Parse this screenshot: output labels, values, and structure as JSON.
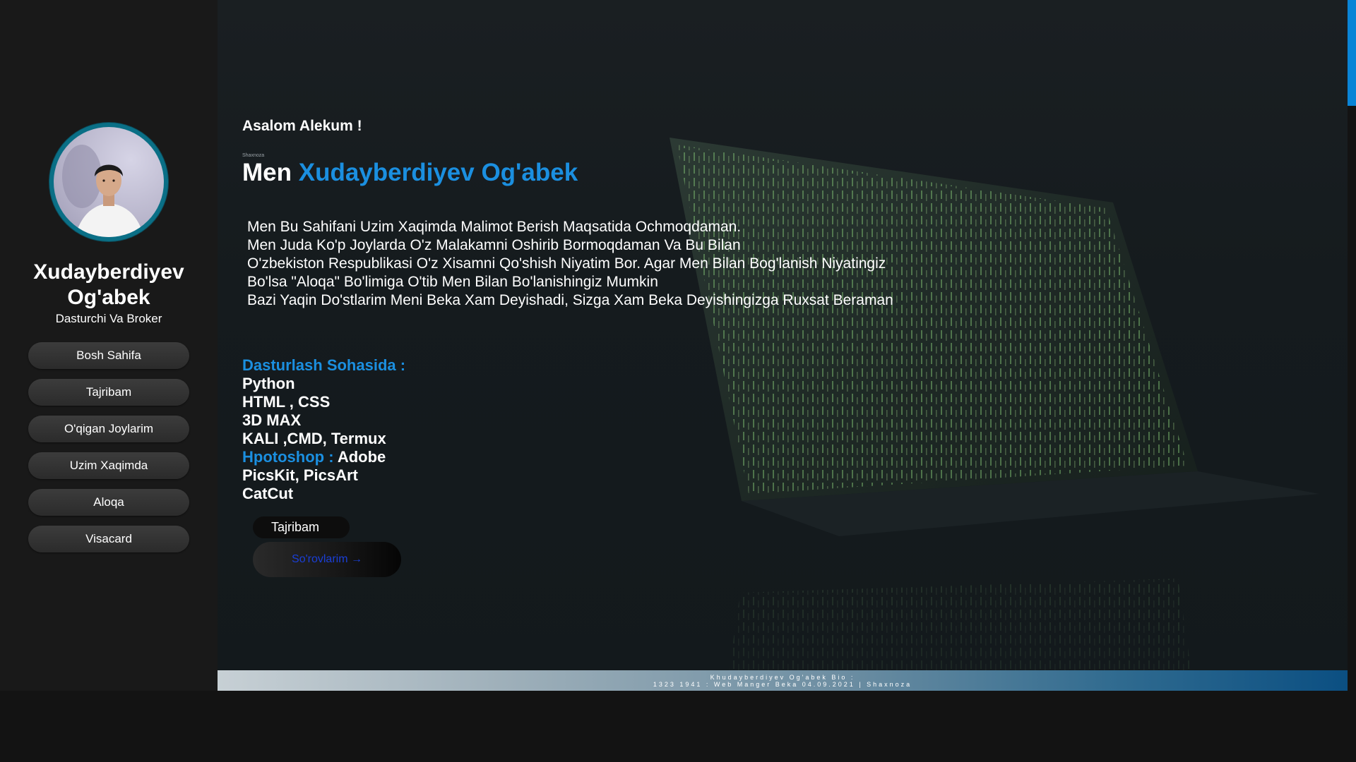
{
  "sidebar": {
    "name_line1": "Xudayberdiyev",
    "name_line2": "Og'abek",
    "role": "Dasturchi Va Broker",
    "nav": [
      {
        "label": "Bosh Sahifa"
      },
      {
        "label": "Tajribam"
      },
      {
        "label": "O'qigan Joylarim"
      },
      {
        "label": "Uzim Xaqimda"
      },
      {
        "label": "Aloqa"
      },
      {
        "label": "Visacard"
      }
    ]
  },
  "main": {
    "greeting": "Asalom Alekum !",
    "tiny_label": "Shaxnoza",
    "headline_prefix": "Men ",
    "headline_name": "Xudayberdiyev Og'abek",
    "bio": [
      "Men Bu Sahifani Uzim Xaqimda Malimot Berish Maqsatida Ochmoqdaman.",
      "Men Juda Ko'p Joylarda O'z Malakamni Oshirib Bormoqdaman Va Bu Bilan",
      "O'zbekiston Respublikasi O'z Xisamni Qo'shish Niyatim Bor. Agar Men Bilan Bog'lanish Niyatingiz",
      "Bo'lsa \"Aloqa\" Bo'limiga O'tib Men Bilan Bo'lanishingiz Mumkin",
      "Bazi Yaqin Do'stlarim Meni Beka Xam Deyishadi, Sizga Xam Beka Deyishingizga Ruxsat Beraman"
    ],
    "skills_heading": "Dasturlash Sohasida :",
    "skills": [
      "Python",
      "HTML , CSS",
      "3D MAX",
      "KALI ,CMD, Termux"
    ],
    "photoshop_label": "Hpotoshop : ",
    "photoshop_value": "Adobe",
    "skills_extra": [
      "PicsKit, PicsArt",
      "CatCut"
    ],
    "button_experience": "Tajribam",
    "button_request": "So'rovlarim  →"
  },
  "footer": {
    "line1": "Khudayberdiyev Og'abek Bio :",
    "line2": "1323 1941 : Web Manger Beka 04.09.2021 | Shaxnoza"
  },
  "colors": {
    "accent": "#1b8fe0",
    "scrollbar": "#0a84d6",
    "avatar_ring": "#0a6f86"
  }
}
